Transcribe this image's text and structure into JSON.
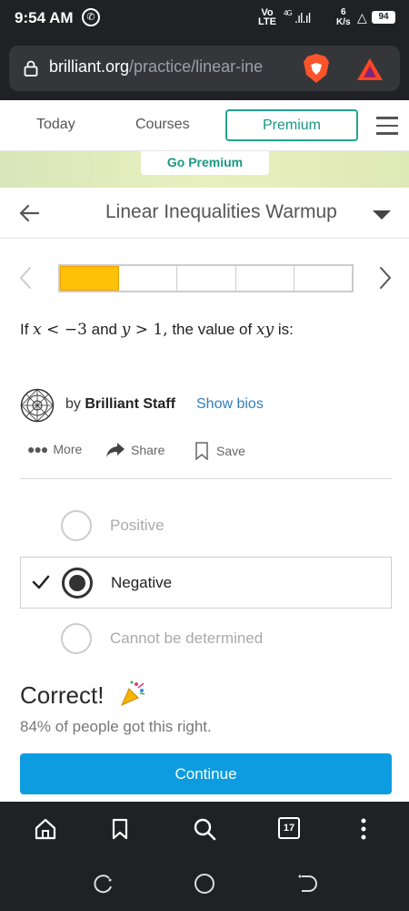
{
  "status_bar": {
    "time": "9:54 AM",
    "network_top": "Vo",
    "network_bottom": "LTE",
    "network_4g": "4G",
    "speed_value": "6",
    "speed_unit": "K/s",
    "battery": "94"
  },
  "browser": {
    "url_domain": "brilliant.org",
    "url_path": "/practice/linear-ine",
    "open_tabs": "17"
  },
  "site_nav": {
    "today": "Today",
    "courses": "Courses",
    "premium": "Premium",
    "banner_cta": "Go Premium"
  },
  "header": {
    "title": "Linear Inequalities Warmup"
  },
  "progress": {
    "total_steps": 5,
    "completed_steps": 1
  },
  "question": {
    "prefix": "If ",
    "x": "x",
    "lt": " < ",
    "neg3": "−3",
    "and": " and ",
    "y": "y",
    "gt": " > ",
    "one": "1",
    "comma": ",",
    "middle": " the value of ",
    "xy": "xy",
    "suffix": " is:"
  },
  "author": {
    "by": "by ",
    "name": "Brilliant Staff",
    "show_bios": "Show bios"
  },
  "actions": {
    "more": "More",
    "share": "Share",
    "save": "Save"
  },
  "options": [
    {
      "label": "Positive",
      "selected": false
    },
    {
      "label": "Negative",
      "selected": true
    },
    {
      "label": "Cannot be determined",
      "selected": false
    }
  ],
  "result": {
    "title": "Correct!",
    "stat": "84% of people got this right.",
    "continue": "Continue"
  }
}
